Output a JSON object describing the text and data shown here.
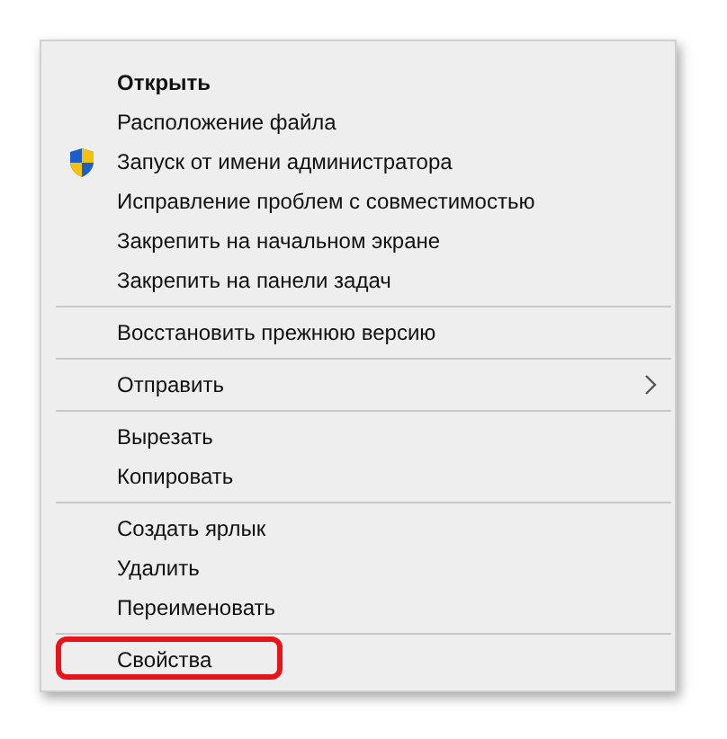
{
  "menu": {
    "groups": [
      {
        "items": [
          {
            "label": "Открыть",
            "kind": "plain",
            "bold": true,
            "highlighted": false
          },
          {
            "label": "Расположение файла",
            "kind": "plain",
            "bold": false,
            "highlighted": false
          },
          {
            "label": "Запуск от имени администратора",
            "kind": "shield",
            "bold": false,
            "highlighted": false
          },
          {
            "label": "Исправление проблем с совместимостью",
            "kind": "plain",
            "bold": false,
            "highlighted": false
          },
          {
            "label": "Закрепить на начальном экране",
            "kind": "plain",
            "bold": false,
            "highlighted": false
          },
          {
            "label": "Закрепить на панели задач",
            "kind": "plain",
            "bold": false,
            "highlighted": false
          }
        ]
      },
      {
        "items": [
          {
            "label": "Восстановить прежнюю версию",
            "kind": "plain",
            "bold": false,
            "highlighted": false
          }
        ]
      },
      {
        "items": [
          {
            "label": "Отправить",
            "kind": "submenu",
            "bold": false,
            "highlighted": false
          }
        ]
      },
      {
        "items": [
          {
            "label": "Вырезать",
            "kind": "plain",
            "bold": false,
            "highlighted": false
          },
          {
            "label": "Копировать",
            "kind": "plain",
            "bold": false,
            "highlighted": false
          }
        ]
      },
      {
        "items": [
          {
            "label": "Создать ярлык",
            "kind": "plain",
            "bold": false,
            "highlighted": false
          },
          {
            "label": "Удалить",
            "kind": "plain",
            "bold": false,
            "highlighted": false
          },
          {
            "label": "Переименовать",
            "kind": "plain",
            "bold": false,
            "highlighted": false
          }
        ]
      },
      {
        "items": [
          {
            "label": "Свойства",
            "kind": "plain",
            "bold": false,
            "highlighted": true
          }
        ]
      }
    ]
  }
}
